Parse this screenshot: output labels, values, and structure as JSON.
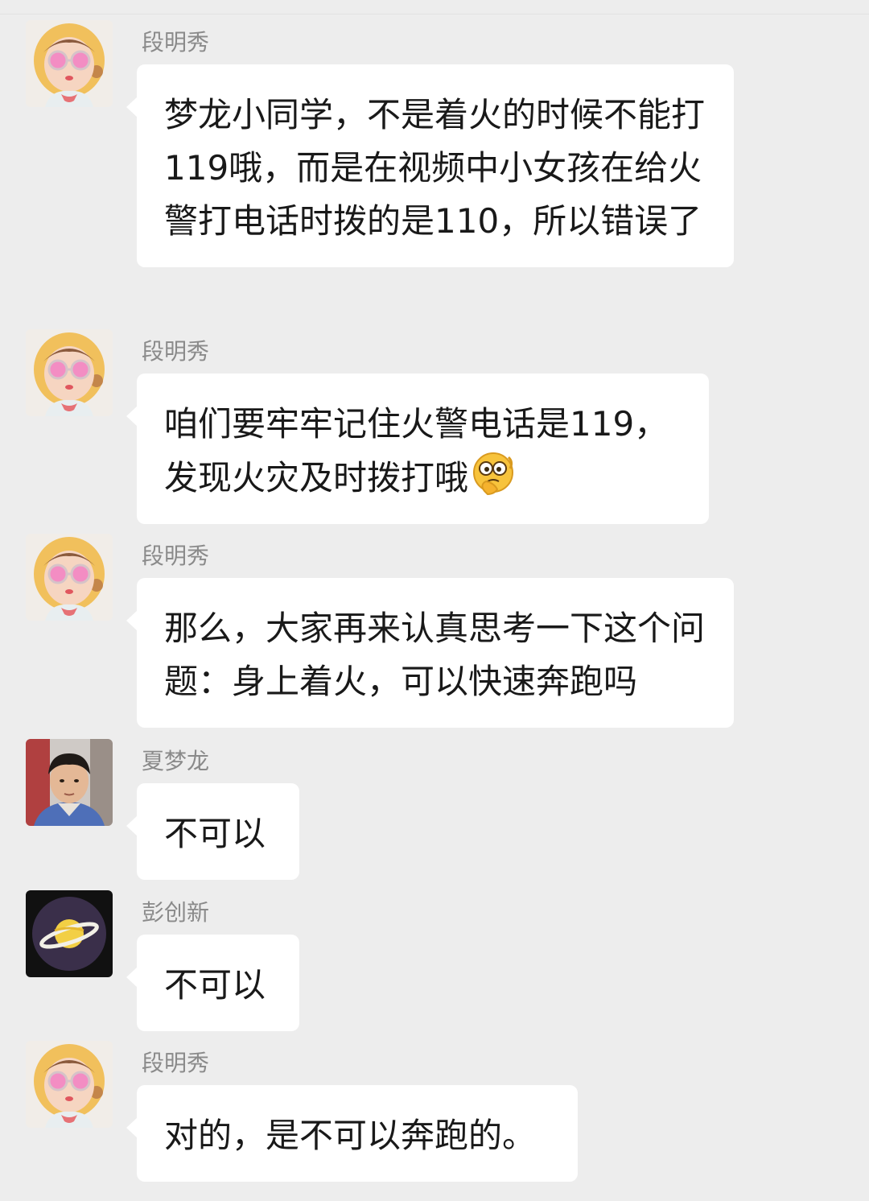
{
  "messages": [
    {
      "sender": "段明秀",
      "avatar": "cartoon-girl-avatar",
      "text": "梦龙小同学，不是着火的时候不能打119哦，而是在视频中小女孩在给火警打电话时拨的是110，所以错误了"
    },
    {
      "sender": "段明秀",
      "avatar": "cartoon-girl-avatar",
      "text": "咱们要牢牢记住火警电话是119，发现火灾及时拨打哦",
      "emoji": "thinking-emoji"
    },
    {
      "sender": "段明秀",
      "avatar": "cartoon-girl-avatar",
      "text": "那么，大家再来认真思考一下这个问题：身上着火，可以快速奔跑吗"
    },
    {
      "sender": "夏梦龙",
      "avatar": "boy-photo-avatar",
      "text": "不可以"
    },
    {
      "sender": "彭创新",
      "avatar": "planet-avatar",
      "text": "不可以"
    },
    {
      "sender": "段明秀",
      "avatar": "cartoon-girl-avatar",
      "text": "对的，是不可以奔跑的。"
    }
  ],
  "colors": {
    "background": "#ededed",
    "bubble": "#ffffff",
    "sender_name": "#8a8a8a",
    "text": "#191919"
  }
}
